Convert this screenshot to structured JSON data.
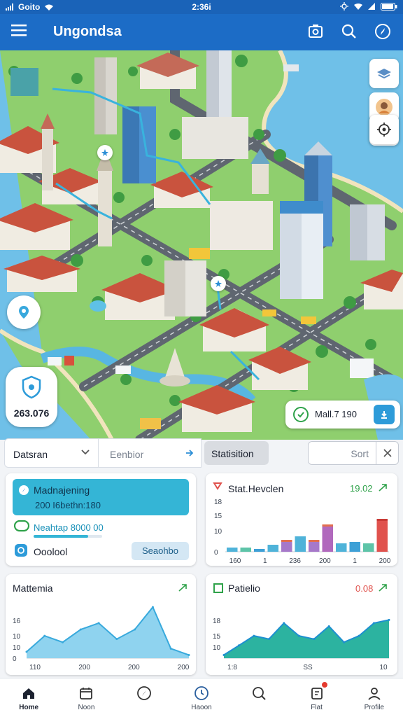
{
  "status_bar": {
    "carrier": "Goito",
    "time": "2:36i"
  },
  "app": {
    "title": "Ungondsa"
  },
  "map": {
    "stat_chip_value": "263.076",
    "badge_text": "Mall.7 190"
  },
  "filters": {
    "tab_a": "Datsran",
    "tab_b": "Eenbior",
    "stat_tab": "Statisition",
    "sort": "Sort"
  },
  "list_card": {
    "item1_title": "Madnajening",
    "item1_sub": "200 I6bethn:180",
    "item2_text": "Neahtap 8000 00",
    "item2_progress": 0.8,
    "item3_text": "Ooolool",
    "item3_button": "Seaohbo"
  },
  "chart_data": [
    {
      "type": "bar",
      "title": "Stat.Hevclen",
      "header_value": "19.02",
      "ylim": [
        0,
        18
      ],
      "yticks": [
        "18",
        "15",
        "10",
        "0"
      ],
      "x_ticks": [
        "160",
        "1",
        "236",
        "200",
        "1",
        "200"
      ],
      "bars": [
        {
          "value": 1.5,
          "color": "#4fb3d9"
        },
        {
          "value": 1.5,
          "color": "#5dc4a8"
        },
        {
          "value": 1.0,
          "color": "#3ea0d6"
        },
        {
          "value": 2.5,
          "color": "#4fb3d9"
        },
        {
          "value": 3.5,
          "color": "#a678c9"
        },
        {
          "value": 5.5,
          "color": "#4fb3d9"
        },
        {
          "value": 3.5,
          "color": "#a678c9"
        },
        {
          "value": 9.0,
          "color": "#b169bd"
        },
        {
          "value": 3.0,
          "color": "#4fb3d9"
        },
        {
          "value": 3.5,
          "color": "#3ea0d6"
        },
        {
          "value": 3.0,
          "color": "#5dc4a8"
        },
        {
          "value": 11.0,
          "color": "#e0524d"
        }
      ]
    },
    {
      "type": "area",
      "title": "Mattemia",
      "ylim": [
        0,
        18
      ],
      "yticks": [
        "16",
        "10",
        "10",
        "0"
      ],
      "x_ticks": [
        "110",
        "200",
        "200",
        "200"
      ],
      "values": [
        2,
        7,
        5,
        9,
        11,
        6,
        9,
        16,
        3,
        1
      ]
    },
    {
      "type": "area",
      "title": "Patielio",
      "header_value": "0.08",
      "ylim": [
        0,
        18
      ],
      "yticks": [
        "18",
        "15",
        "10"
      ],
      "x_ticks": [
        "1:8",
        "SS",
        "10"
      ],
      "values": [
        1,
        4,
        7,
        6,
        11,
        7,
        6,
        10,
        5,
        7,
        11,
        12
      ]
    }
  ],
  "bottom_nav": [
    {
      "label": "Home",
      "icon": "home-icon"
    },
    {
      "label": "Noon",
      "icon": "calendar-icon"
    },
    {
      "label": "",
      "icon": "compass-icon"
    },
    {
      "label": "Haoon",
      "icon": "clock-icon"
    },
    {
      "label": "",
      "icon": "search-icon"
    },
    {
      "label": "Flat",
      "icon": "alerts-icon"
    },
    {
      "label": "Profile",
      "icon": "profile-icon"
    }
  ],
  "colors": {
    "brand": "#1c6cc6",
    "accent": "#34b5d6",
    "positive": "#2fa24a",
    "negative": "#e0524d"
  }
}
